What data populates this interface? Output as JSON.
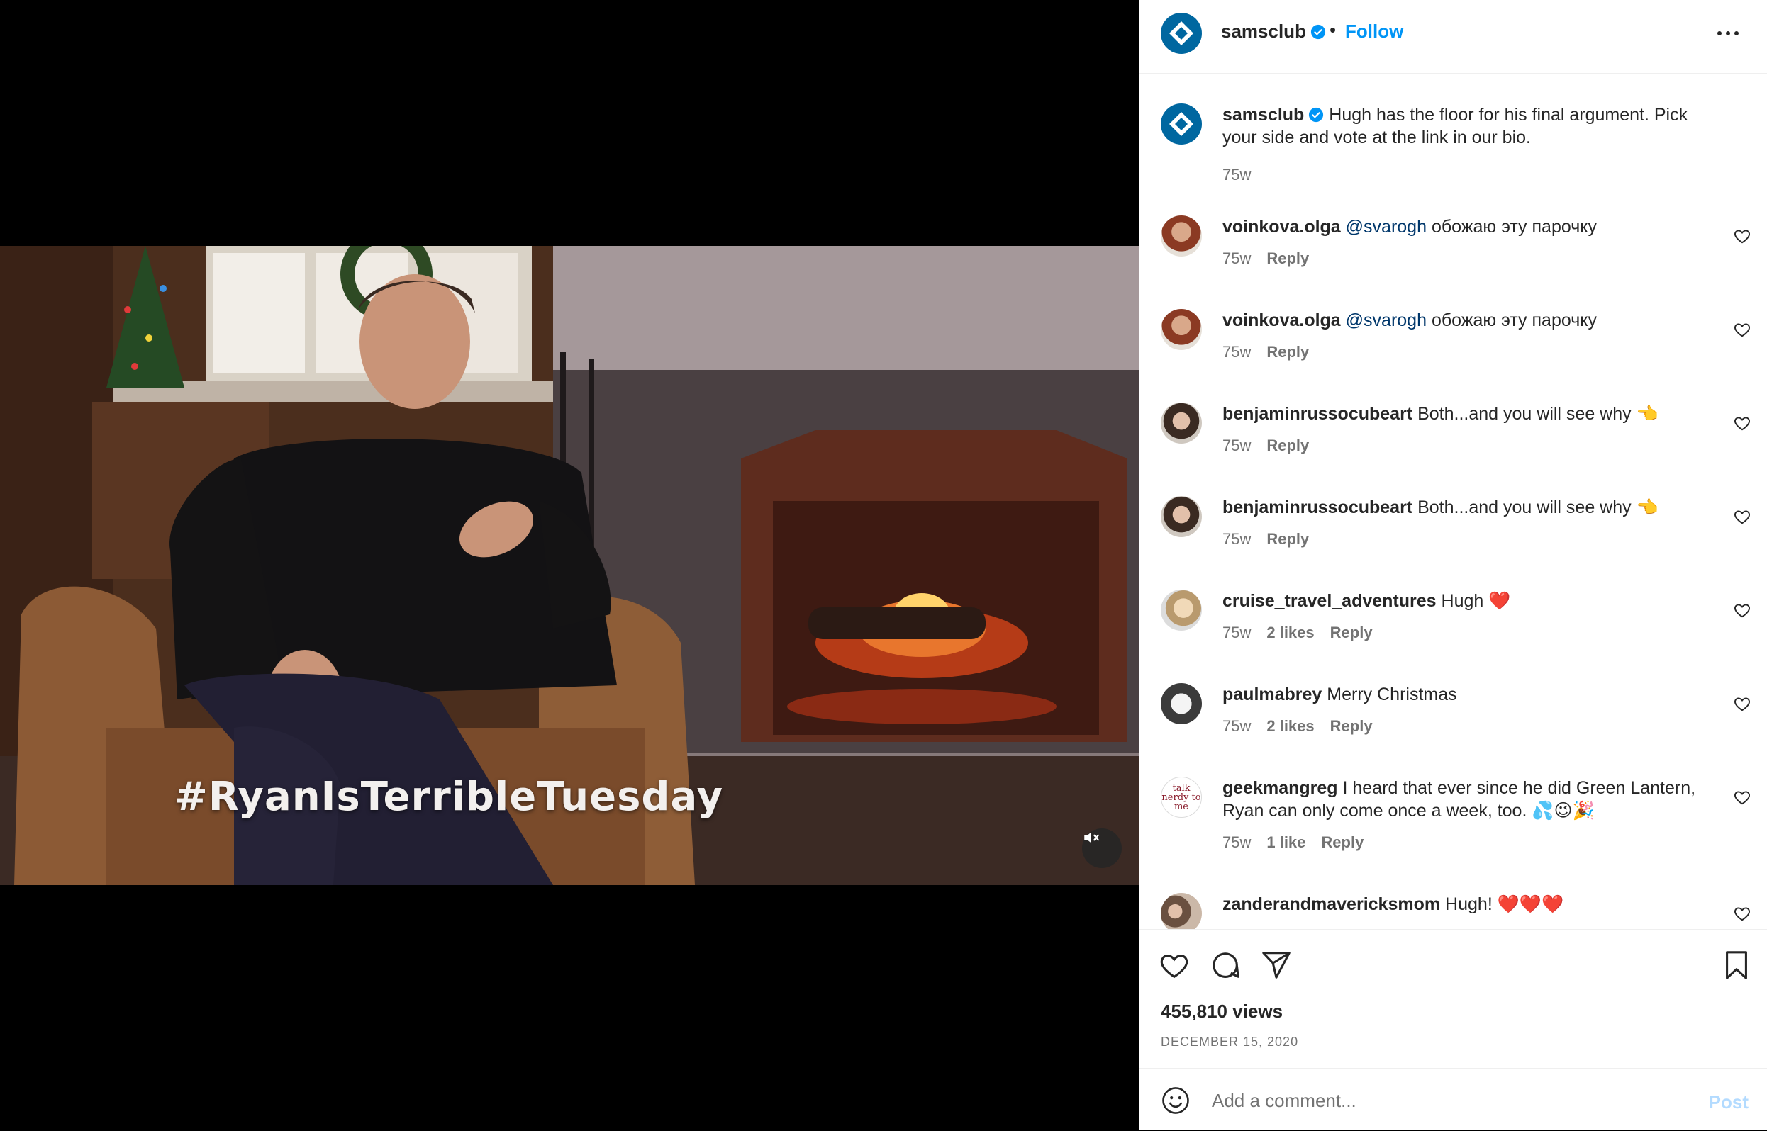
{
  "video": {
    "caption": "#RyanIsTerribleTuesday",
    "mute_icon": "muted-speaker-icon"
  },
  "header": {
    "username": "samsclub",
    "dot": "•",
    "follow_label": "Follow",
    "more_icon": "more-options-icon"
  },
  "caption": {
    "username": "samsclub",
    "text": "Hugh has the floor for his final argument. Pick your side and vote at the link in our bio.",
    "time": "75w"
  },
  "comments": [
    {
      "username": "voinkova.olga",
      "mention": "@svarogh",
      "text": " обожаю эту парочку",
      "time": "75w",
      "likes": "",
      "reply": "Reply"
    },
    {
      "username": "voinkova.olga",
      "mention": "@svarogh",
      "text": " обожаю эту парочку",
      "time": "75w",
      "likes": "",
      "reply": "Reply"
    },
    {
      "username": "benjaminrussocubeart",
      "mention": "",
      "text": "Both...and you will see why 👈",
      "time": "75w",
      "likes": "",
      "reply": "Reply"
    },
    {
      "username": "benjaminrussocubeart",
      "mention": "",
      "text": "Both...and you will see why 👈",
      "time": "75w",
      "likes": "",
      "reply": "Reply"
    },
    {
      "username": "cruise_travel_adventures",
      "mention": "",
      "text": "Hugh ❤️",
      "time": "75w",
      "likes": "2 likes",
      "reply": "Reply"
    },
    {
      "username": "paulmabrey",
      "mention": "",
      "text": "Merry Christmas",
      "time": "75w",
      "likes": "2 likes",
      "reply": "Reply"
    },
    {
      "username": "geekmangreg",
      "mention": "",
      "text": "I heard that ever since he did Green Lantern, Ryan can only come once a week, too. 💦😉🎉",
      "time": "75w",
      "likes": "1 like",
      "reply": "Reply"
    },
    {
      "username": "zanderandmavericksmom",
      "mention": "",
      "text": "Hugh! ❤️❤️❤️",
      "time": "",
      "likes": "",
      "reply": ""
    }
  ],
  "avatar_text": {
    "geekmangreg": "talk nerdy to me"
  },
  "actions": {
    "views": "455,810 views",
    "date": "DECEMBER 15, 2020"
  },
  "composer": {
    "placeholder": "Add a comment...",
    "post_label": "Post"
  },
  "colors": {
    "accent": "#0095f6",
    "brand": "#0067a0",
    "post_disabled": "#b3dbff"
  }
}
